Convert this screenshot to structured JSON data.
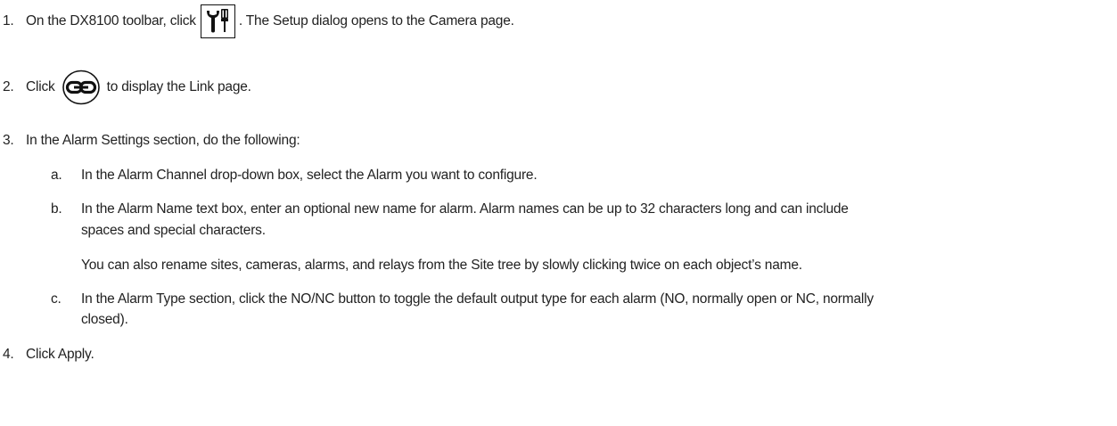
{
  "steps": [
    {
      "number": "1.",
      "before": "On the DX8100 toolbar, click",
      "icon": "setup-tools-icon",
      "after": ". The Setup dialog opens to the Camera page."
    },
    {
      "number": "2.",
      "before": "Click",
      "icon": "link-icon",
      "after": "to display the Link page."
    },
    {
      "number": "3.",
      "text": "In the Alarm Settings section, do the following:",
      "substeps": [
        {
          "letter": "a.",
          "text": "In the Alarm Channel drop-down box, select the Alarm you want to configure."
        },
        {
          "letter": "b.",
          "line1": "In the Alarm Name text box, enter an optional new name for alarm. Alarm names can be up to 32 characters long and can include",
          "line2": "spaces and special characters.",
          "note": "You can also rename sites, cameras, alarms, and relays from the Site tree by slowly clicking twice on each object’s name."
        },
        {
          "letter": "c.",
          "line1": "In the Alarm Type section, click the NO/NC button to toggle the default output type for each alarm (NO, normally open or NC, normally",
          "line2": "closed)."
        }
      ]
    },
    {
      "number": "4.",
      "text": "Click Apply."
    }
  ]
}
